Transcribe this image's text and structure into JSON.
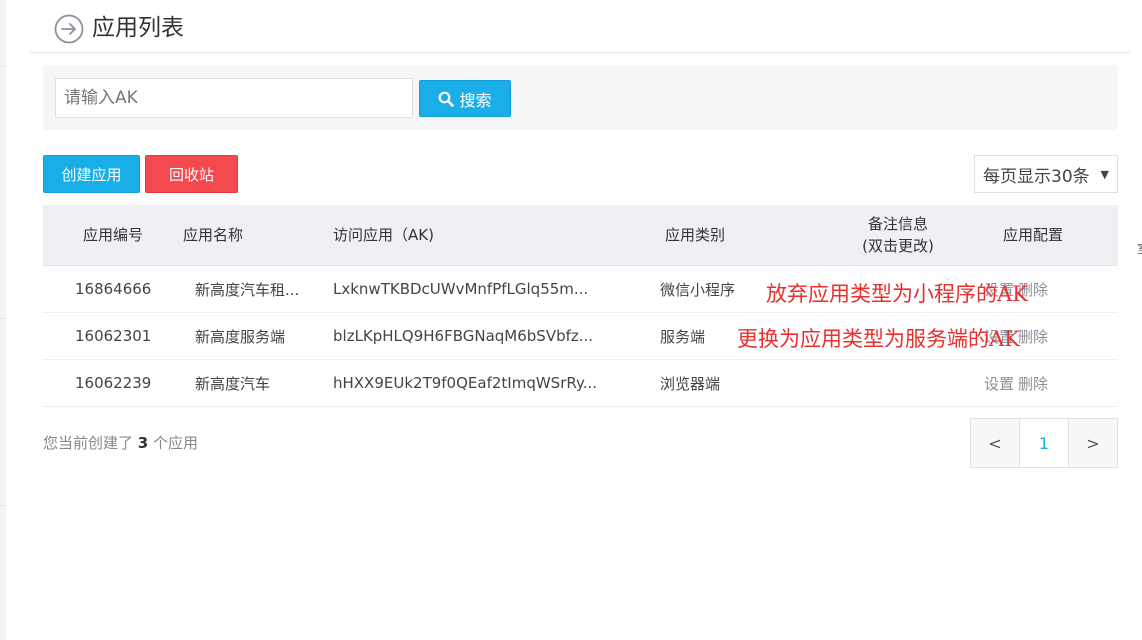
{
  "header": {
    "title": "应用列表"
  },
  "search": {
    "placeholder": "请输入AK",
    "value": "",
    "button_label": "搜索"
  },
  "toolbar": {
    "create_label": "创建应用",
    "recycle_label": "回收站",
    "page_size_selected": "每页显示30条"
  },
  "table": {
    "columns": [
      "应用编号",
      "应用名称",
      "访问应用（AK)",
      "应用类别",
      "备注信息",
      "(双击更改)",
      "应用配置"
    ],
    "rows": [
      {
        "id": "16864666",
        "name": "新高度汽车租...",
        "ak": "LxknwTKBDcUWvMnfPfLGlq55m...",
        "type": "微信小程序",
        "note": "",
        "op_settings": "设置",
        "op_delete": "删除"
      },
      {
        "id": "16062301",
        "name": "新高度服务端",
        "ak": "blzLKpHLQ9H6FBGNaqM6bSVbfz...",
        "type": "服务端",
        "note": "",
        "op_settings": "设置",
        "op_delete": "删除"
      },
      {
        "id": "16062239",
        "name": "新高度汽车",
        "ak": "hHXX9EUk2T9f0QEaf2tImqWSrRy...",
        "type": "浏览器端",
        "note": "",
        "op_settings": "设置",
        "op_delete": "删除"
      }
    ]
  },
  "annotations": [
    "放弃应用类型为小程序的AK",
    "更换为应用类型为服务端的AK"
  ],
  "summary": {
    "prefix": "您当前创建了",
    "count": "3",
    "suffix": "个应用"
  },
  "pagination": {
    "prev": "<",
    "current": "1",
    "next": ">"
  },
  "edge_fragment": "室",
  "colors": {
    "primary": "#1aaee8",
    "danger": "#f44a4f",
    "annotation": "#e8302f"
  },
  "icons": {
    "back": "arrow-right-circle-icon",
    "search": "magnifier-icon",
    "caret": "caret-down-icon"
  }
}
